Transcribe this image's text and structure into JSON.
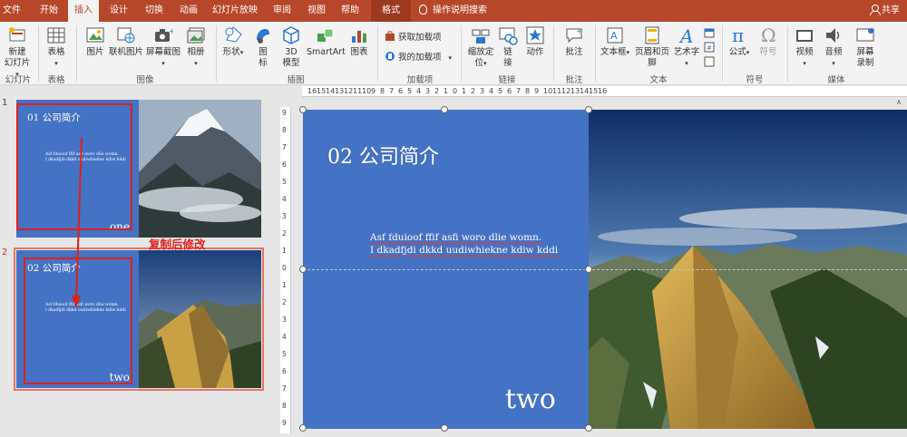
{
  "tabs": [
    "文件",
    "开始",
    "插入",
    "设计",
    "切换",
    "动画",
    "幻灯片放映",
    "审阅",
    "视图",
    "帮助",
    "格式"
  ],
  "active_tab": "插入",
  "tell_me": "操作说明搜索",
  "share": "共享",
  "ribbon": {
    "new_slide": "新建\n幻灯片",
    "group_slides": "幻灯片",
    "table": "表格",
    "group_table": "表格",
    "picture": "图片",
    "online_picture": "联机图片",
    "screenshot": "屏幕截图",
    "album": "相册",
    "group_images": "图像",
    "shapes": "形状",
    "icons": "图\n标",
    "model3d": "3D\n模型",
    "smartart": "SmartArt",
    "chart": "图表",
    "group_illustrations": "插图",
    "get_addins": "获取加载项",
    "my_addins": "我的加载项",
    "group_addins": "加载项",
    "zoom": "缩放定\n位",
    "link": "链\n接",
    "action": "动作",
    "group_links": "链接",
    "comment": "批注",
    "group_comments": "批注",
    "textbox": "文本框",
    "header_footer": "页眉和页脚",
    "wordart": "艺术字",
    "group_text": "文本",
    "equation": "公式",
    "symbol": "符号",
    "group_symbols": "符号",
    "video": "视频",
    "audio": "音频",
    "screen_record": "屏幕\n录制",
    "group_media": "媒体"
  },
  "thumbnails": [
    {
      "number": "1",
      "title": "01 公司简介",
      "body1": "Asf fduioof ffif asfi woro dlie womn.",
      "body2": "I dkadfjdi dkkd uudiwhiekne kdiw kddi",
      "footer": "one"
    },
    {
      "number": "2",
      "title": "02 公司简介",
      "body1": "Asf fduioof ffif asfi woro dlie womn.",
      "body2": "I dkadfjdi dkkd uudiwhiekne kdiw kddi",
      "footer": "two"
    }
  ],
  "annotation": "复制后修改",
  "slide": {
    "title": "02 公司简介",
    "body1": "Asf  fduioof  ffif asfi woro dlie womn.",
    "body2": "I dkadfjdi dkkd uudiwhiekne kdiw kddi",
    "footer": "two"
  },
  "ruler_h": [
    "16",
    "15",
    "14",
    "13",
    "12",
    "11",
    "10",
    "9",
    "8",
    "7",
    "6",
    "5",
    "4",
    "3",
    "2",
    "1",
    "0",
    "1",
    "2",
    "3",
    "4",
    "5",
    "6",
    "7",
    "8",
    "9",
    "10",
    "11",
    "12",
    "13",
    "14",
    "15",
    "16"
  ],
  "ruler_v": [
    "9",
    "8",
    "7",
    "6",
    "5",
    "4",
    "3",
    "2",
    "1",
    "0",
    "1",
    "2",
    "3",
    "4",
    "5",
    "6",
    "7",
    "8",
    "9"
  ],
  "colors": {
    "accent": "#b7472a",
    "slide_blue": "#4472c4",
    "annotation": "#e0201b"
  }
}
